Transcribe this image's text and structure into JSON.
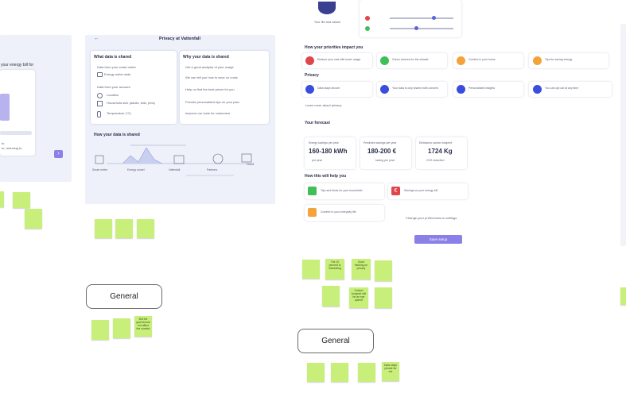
{
  "left_panel": {
    "heading_fragment": "your energy bill for",
    "lines": [
      "to",
      "to, reducing to",
      "ten"
    ]
  },
  "privacy_panel": {
    "back_icon": "arrow-left-icon",
    "title": "Privacy at Vattenfall",
    "what_shared": {
      "heading": "What data is shared",
      "group1_title": "Data from your smart meter",
      "item1": "Energy meter data",
      "group2_title": "Data from your account",
      "items": [
        "Location",
        "Household size (adults, kids, pets)",
        "Temperature (°C)",
        "Consumption data"
      ]
    },
    "why_shared": {
      "heading": "Why your data is shared",
      "bullets": [
        "Get a good analysis of your usage",
        "We can tell you how to save on costs",
        "Help us find the best prices for you",
        "Provide personalised tips on your plan",
        "Improve our tools for customers"
      ]
    },
    "how_shared": {
      "heading": "How your data is shared",
      "labels": [
        "Smart meter",
        "Energy model",
        "Vattenfall",
        "Partners",
        "Cloud"
      ]
    }
  },
  "right_panel": {
    "avatar_caption": "Your life and values",
    "priorities_title": "How your priorities impact you",
    "priority_cards": [
      "Reduce your cost with lower usage",
      "Green choices for the climate",
      "Comfort in your home",
      "Tips for saving energy"
    ],
    "privacy_title": "Privacy",
    "privacy_cards": [
      "Data stays secure",
      "Your data is only shared with consent",
      "Personalised insights",
      "You can opt out at any time"
    ],
    "privacy_link": "Learn more about privacy",
    "forecast_title": "Your forecast",
    "forecast": [
      {
        "label": "Energy savings per year",
        "value": "160-180 kWh",
        "sub": "per year"
      },
      {
        "label": "Predicted savings per year",
        "value": "180-200 €",
        "sub": "saving per year"
      },
      {
        "label": "Emissions carbon footprint",
        "value": "1724 Kg",
        "sub": "CO2 reduction"
      }
    ],
    "help_title": "How this will help you",
    "help_cards": [
      "Tips and tricks for your household",
      "Savings on your energy bill",
      "Comfort in your everyday life"
    ],
    "help_link": "Change your preferences in settings",
    "save_button": "Save setup"
  },
  "general_buttons": [
    "General",
    "General"
  ],
  "stickies": [
    "The 10 percent is interesting",
    "Good thinking on privacy",
    "Carbon footprint will be an eye opener",
    "But the goal should not affect the comfort",
    "Data stays private for me"
  ],
  "colors": {
    "panel_bg": "#eef0fa",
    "accent": "#8b7fe8",
    "sticky": "#c8ef7a",
    "red": "#e0454c",
    "green": "#3fbf58",
    "orange": "#f4a23a",
    "blue": "#3a4de0"
  }
}
